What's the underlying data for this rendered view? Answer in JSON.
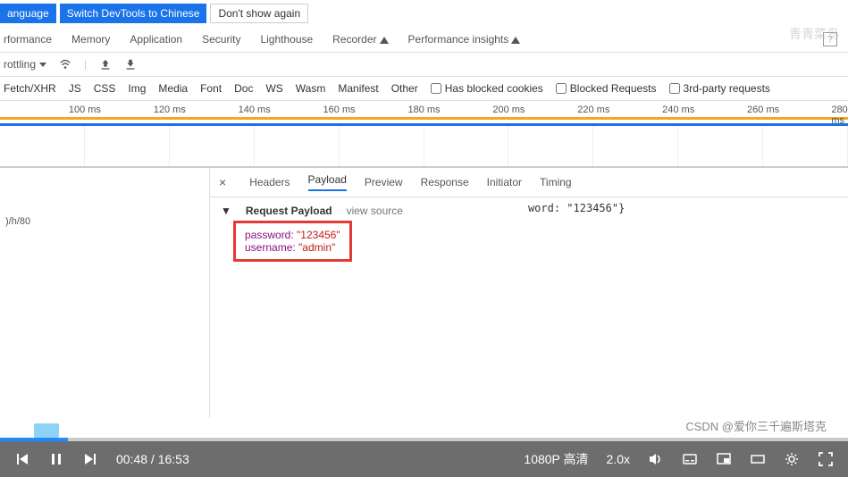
{
  "topbar": {
    "lang": "anguage",
    "switch": "Switch DevTools to Chinese",
    "dismiss": "Don't show again"
  },
  "tabs": {
    "perf": "rformance",
    "memory": "Memory",
    "app": "Application",
    "security": "Security",
    "lighthouse": "Lighthouse",
    "recorder": "Recorder",
    "insights": "Performance insights",
    "help": "?"
  },
  "toolbar": {
    "throttling": "rottling"
  },
  "filters": {
    "fetch": "Fetch/XHR",
    "js": "JS",
    "css": "CSS",
    "img": "Img",
    "media": "Media",
    "font": "Font",
    "doc": "Doc",
    "ws": "WS",
    "wasm": "Wasm",
    "manifest": "Manifest",
    "other": "Other",
    "blocked_cookies": "Has blocked cookies",
    "blocked_req": "Blocked Requests",
    "third_party": "3rd-party requests"
  },
  "timeline": {
    "ticks": [
      "100 ms",
      "120 ms",
      "140 ms",
      "160 ms",
      "180 ms",
      "200 ms",
      "220 ms",
      "240 ms",
      "260 ms",
      "280 ms"
    ]
  },
  "left": {
    "item": ")/h/80"
  },
  "detail": {
    "headers": "Headers",
    "payload": "Payload",
    "preview": "Preview",
    "response": "Response",
    "initiator": "Initiator",
    "timing": "Timing"
  },
  "payload": {
    "title": "Request Payload",
    "view_source": "view source",
    "inline_suffix": "word: \"123456\"}",
    "password_key": "password:",
    "password_val": "\"123456\"",
    "username_key": "username:",
    "username_val": "\"admin\""
  },
  "watermark": "青青菜鸟",
  "video": {
    "time": "00:48 / 16:53",
    "quality": "1080P 高清",
    "speed": "2.0x"
  },
  "csdn": "CSDN @爱你三千遍斯塔克"
}
